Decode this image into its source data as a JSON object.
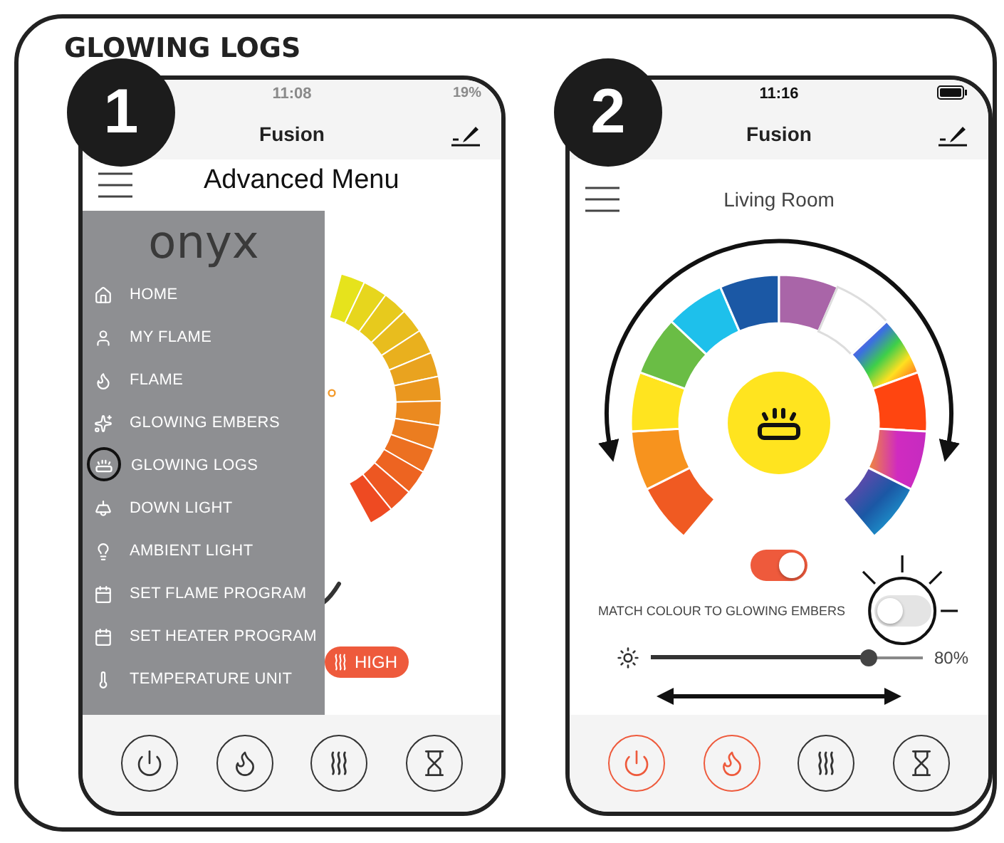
{
  "title": "GLOWING LOGS",
  "phones": [
    {
      "kind": "menu",
      "step": "1",
      "status": {
        "time": "11:08",
        "battery": "19%"
      },
      "app_title": "Fusion",
      "overlay_label": "Advanced Menu",
      "menu": {
        "logo": "onyx",
        "items": [
          "HOME",
          "MY FLAME",
          "FLAME",
          "GLOWING EMBERS",
          "GLOWING LOGS",
          "DOWN LIGHT",
          "AMBIENT LIGHT",
          "SET FLAME PROGRAM",
          "SET HEATER PROGRAM",
          "TEMPERATURE UNIT"
        ]
      },
      "heat_badge": "HIGH",
      "nav": [
        {
          "active": false
        },
        {
          "active": false
        },
        {
          "active": false
        },
        {
          "active": false
        }
      ]
    },
    {
      "kind": "color",
      "step": "2",
      "status": {
        "time": "11:16"
      },
      "app_title": "Fusion",
      "room": "Living Room",
      "glow_on": true,
      "match": {
        "label": "MATCH COLOUR TO GLOWING EMBERS",
        "on": false
      },
      "brightness": {
        "level": 0.8,
        "reading": "80%"
      },
      "nav": [
        {
          "active": true
        },
        {
          "active": true
        },
        {
          "active": false
        },
        {
          "active": false
        }
      ]
    }
  ]
}
